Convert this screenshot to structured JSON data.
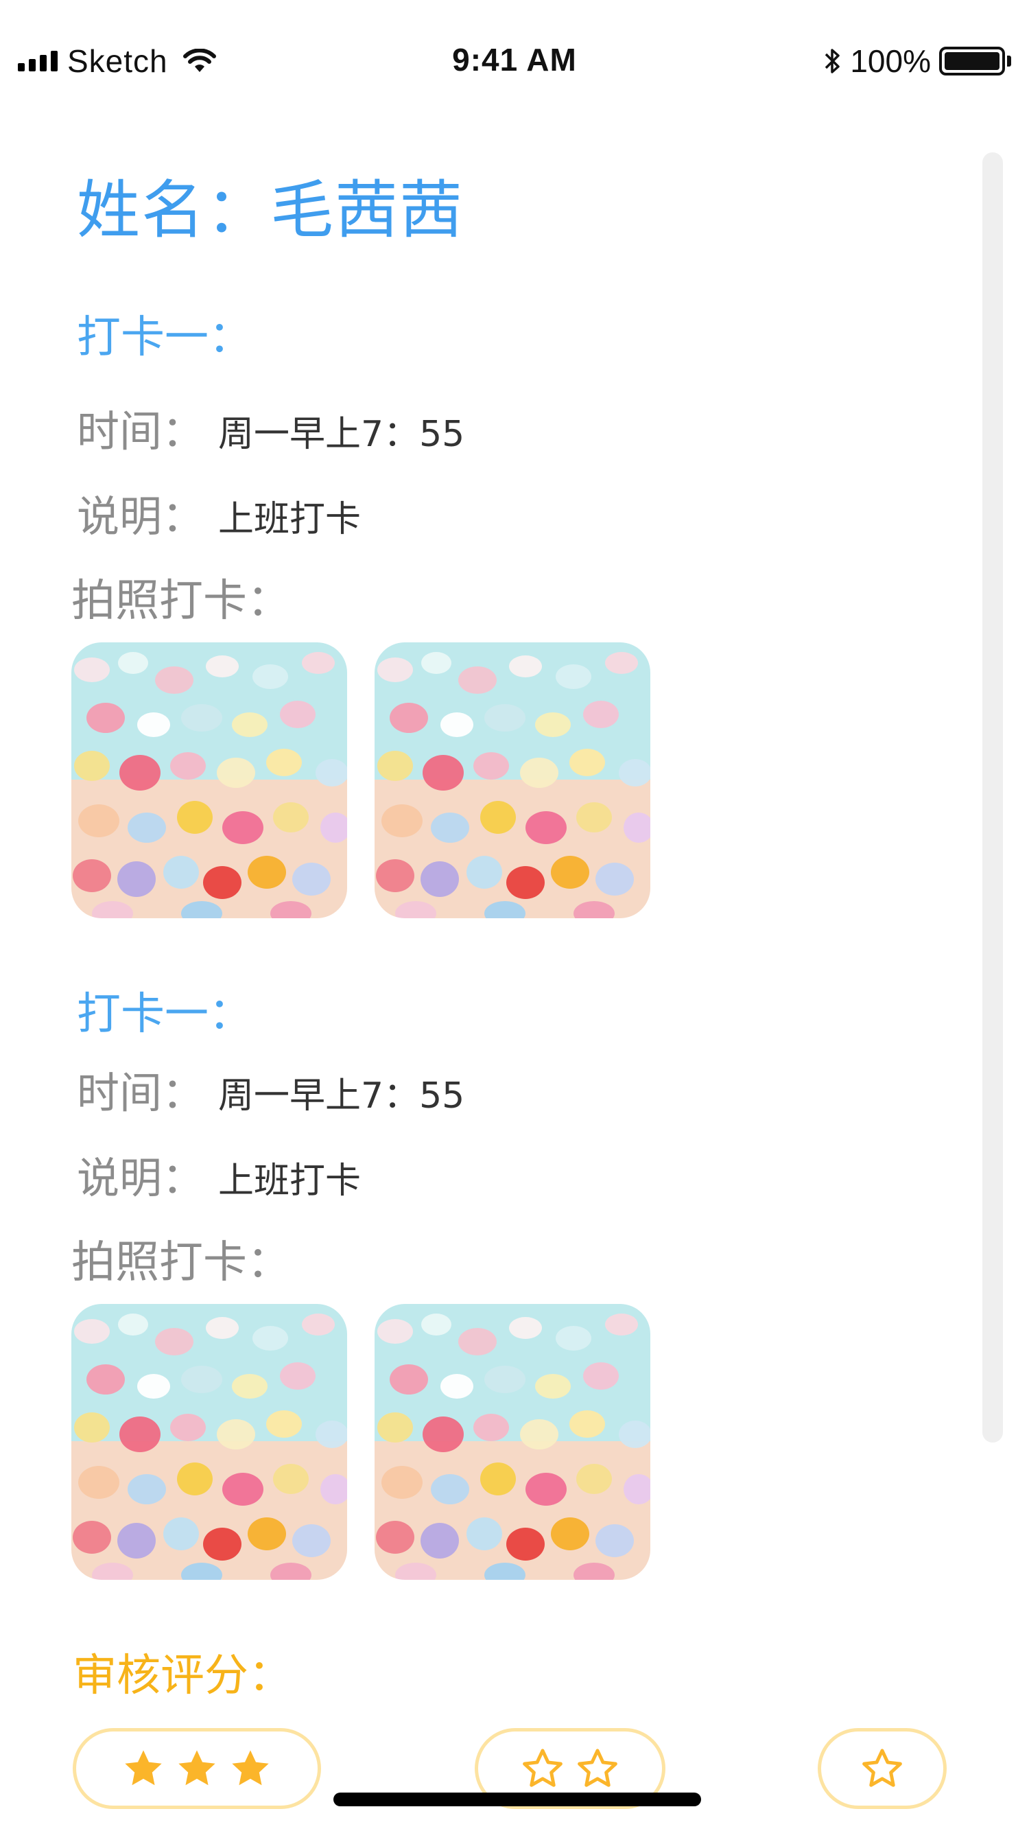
{
  "status_bar": {
    "carrier": "Sketch",
    "time": "9:41 AM",
    "battery": "100%"
  },
  "name_title": "姓名：毛茜茜",
  "checkins": [
    {
      "title": "打卡一：",
      "time_label": "时间：",
      "time_value": "周一早上7：55",
      "desc_label": "说明：",
      "desc_value": "上班打卡",
      "photo_label": "拍照打卡："
    },
    {
      "title": "打卡一：",
      "time_label": "时间：",
      "time_value": "周一早上7：55",
      "desc_label": "说明：",
      "desc_value": "上班打卡",
      "photo_label": "拍照打卡："
    }
  ],
  "review": {
    "label": "审核评分：",
    "options": [
      {
        "stars": 3,
        "filled": true
      },
      {
        "stars": 2,
        "filled": false
      },
      {
        "stars": 1,
        "filled": false
      }
    ]
  },
  "colors": {
    "title_blue": "#3f9dee",
    "label_gray": "#8c8c8c",
    "review_orange": "#f7b319",
    "star_gold": "#fbb52a",
    "pill_border": "#fde3a1"
  },
  "icons": [
    "signal-icon",
    "wifi-icon",
    "bluetooth-icon",
    "battery-icon",
    "star-icon",
    "star-outline-icon"
  ]
}
